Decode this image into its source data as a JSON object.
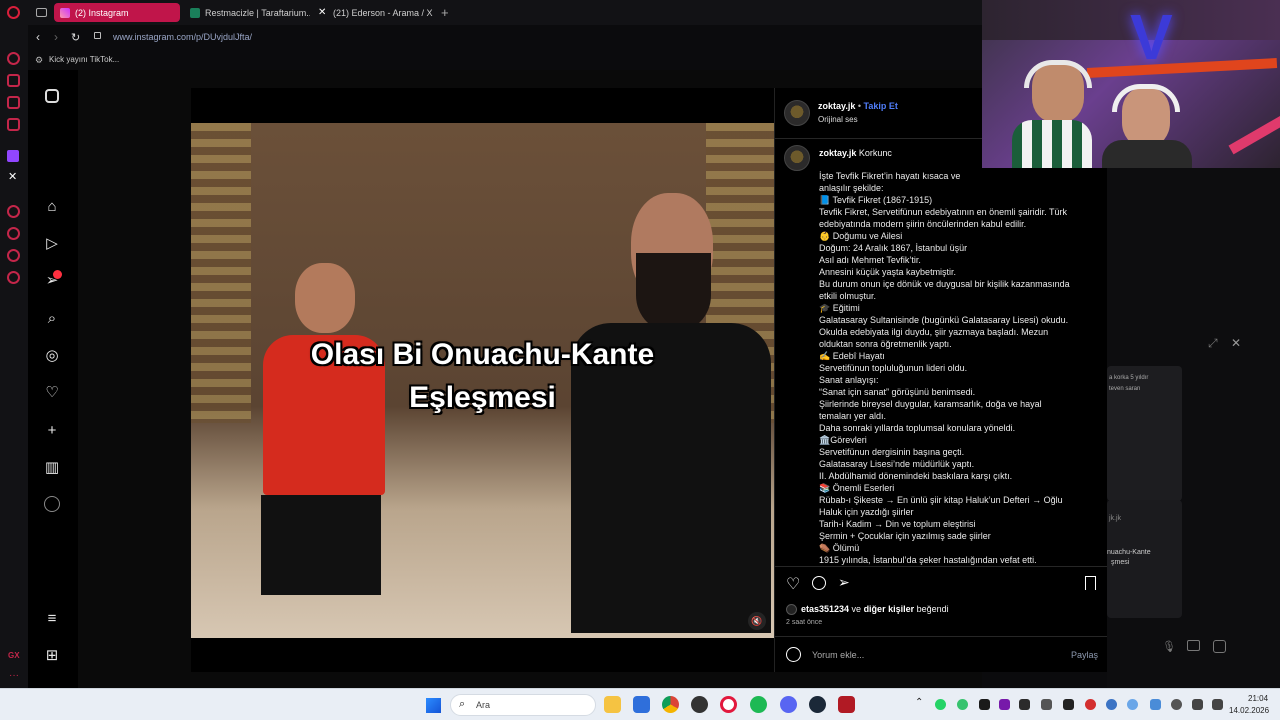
{
  "browser": {
    "tabs": [
      {
        "label": "(2) Instagram",
        "active": true
      },
      {
        "label": "Restmacizle | Taraftarium..."
      },
      {
        "label": "(21) Ederson - Arama / X"
      }
    ],
    "url": "www.instagram.com/p/DUvjdulJfta/",
    "bookmark": "Kick yayını TikTok..."
  },
  "post": {
    "username": "zoktay.jk",
    "follow": "Takip Et",
    "audio": "Orijinal ses",
    "comment_user": "zoktay.jk",
    "comment_word": "Korkunc",
    "video_caption_line1": "Olası Bi Onuachu-Kante",
    "video_caption_line2": "Eşleşmesi",
    "description_lines": [
      "İşte Tevfik Fikret’in hayatı kısaca ve",
      "anlaşılır şekilde:",
      "📘 Tevfik Fikret (1867-1915)",
      "Tevfik Fikret, Servetifünun edebiyatının en önemli şairidir. Türk",
      "edebiyatında modern şiirin öncülerinden kabul edilir.",
      "👶 Doğumu ve Ailesi",
      "Doğum: 24 Aralık 1867, İstanbul üşür",
      "Asıl adı Mehmet Tevfik’tir.",
      "Annesini küçük yaşta kaybetmiştir.",
      "Bu durum onun içe dönük ve duygusal bir kişilik kazanmasında",
      "etkili olmuştur.",
      "🎓 Eğitimi",
      "Galatasaray Sultanisinde (bugünkü Galatasaray Lisesi) okudu.",
      "Okulda edebiyata ilgi duydu, şiir yazmaya başladı. Mezun",
      "olduktan sonra öğretmenlik yaptı.",
      "✍️ Edebî Hayatı",
      "Servetifünun topluluğunun lideri oldu.",
      "Sanat anlayışı:",
      "“Sanat için sanat” görüşünü benimsedi.",
      "Şiirlerinde bireysel duygular, karamsarlık, doğa ve hayal",
      "temaları yer aldı.",
      "Daha sonraki yıllarda toplumsal konulara yöneldi.",
      "🏛️Görevleri",
      "Servetifünun dergisinin başına geçti.",
      "Galatasaray Lisesi’nde müdürlük yaptı.",
      "II. Abdülhamid dönemindeki baskılara karşı çıktı.",
      "📚 Önemli Eserleri",
      "Rübab-ı Şikeste → En ünlü şiir kitap Haluk’un Defteri → Oğlu",
      "Haluk için yazdığı şiirler",
      "Tarih-i Kadim → Din ve toplum eleştirisi",
      "Şermin + Çocuklar için yazılmış sade şiirler",
      "⚰️ Ölümü",
      "1915 yılında, İstanbul’da şeker hastalığından vefat etti."
    ],
    "likes_user": "etas351234",
    "likes_rest": " ve ",
    "likes_others": "diğer kişiler",
    "likes_suffix": " beğendi",
    "time_ago": "2 saat önce",
    "comment_placeholder": "Yorum ekle...",
    "share_button": "Paylaş"
  },
  "background_chat": {
    "snippet1": "a korka 5 yıldır",
    "snippet2": "teven saran",
    "snippet3": "jk.jk",
    "snippet4": "nuachu-Kante",
    "snippet5": "şmesi"
  },
  "taskbar": {
    "search": "Ara",
    "time": "21:04",
    "date": "14.02.2026"
  },
  "colors": {
    "accent_blue": "#4f7df9",
    "opera_red": "#c4264a",
    "active_tab": "#c0154a"
  }
}
